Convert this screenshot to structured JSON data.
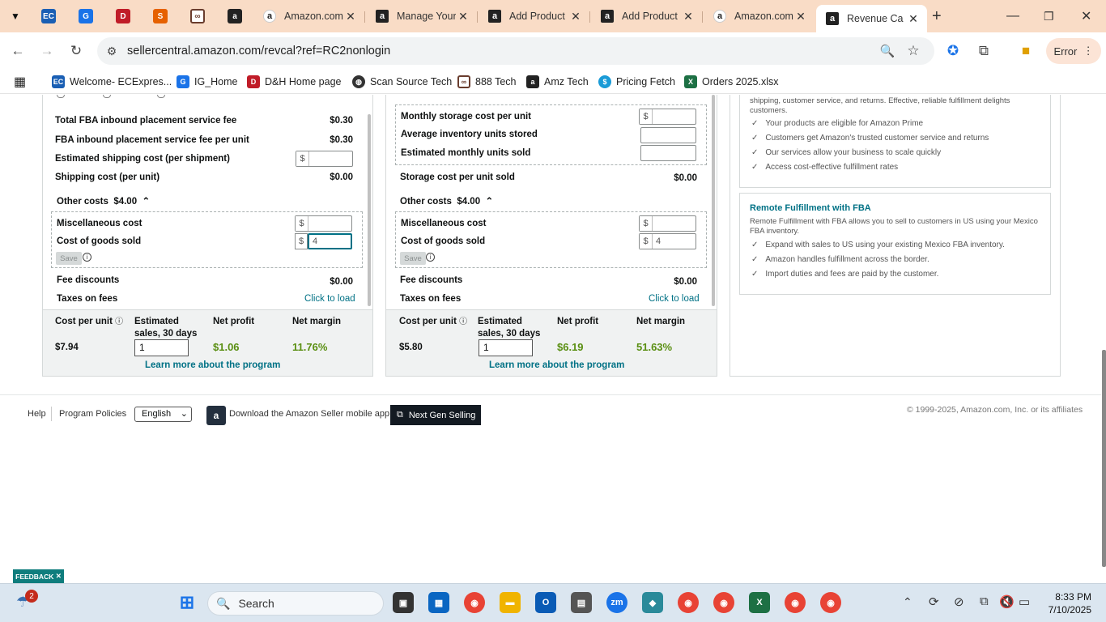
{
  "browser": {
    "tabs": [
      {
        "title": "Amazon.com",
        "favicon": "amazon-smile"
      },
      {
        "title": "Manage Your",
        "favicon": "amazon-a"
      },
      {
        "title": "Add Product",
        "favicon": "amazon-a"
      },
      {
        "title": "Add Product",
        "favicon": "amazon-a"
      },
      {
        "title": "Amazon.com",
        "favicon": "amazon-smile"
      },
      {
        "title": "Revenue Ca",
        "favicon": "amazon-a"
      }
    ],
    "url": "sellercentral.amazon.com/revcal?ref=RC2nonlogin",
    "profile_label": "Error",
    "bookmarks": [
      {
        "label": "Welcome- ECExpres...",
        "icon": "ec-icon",
        "color": "#1a5fb4"
      },
      {
        "label": "IG_Home",
        "icon": "ig-icon",
        "color": "#1a73e8"
      },
      {
        "label": "D&H Home page",
        "icon": "dh-icon",
        "color": "#c01c28"
      },
      {
        "label": "Scan Source Tech",
        "icon": "globe-icon",
        "color": "#333333"
      },
      {
        "label": "888 Tech",
        "icon": "link-icon",
        "color": "#6a3d2e"
      },
      {
        "label": "Amz Tech",
        "icon": "amazon-icon",
        "color": "#222222"
      },
      {
        "label": "Pricing Fetch",
        "icon": "dollar-icon",
        "color": "#1a9bd7"
      },
      {
        "label": "Orders 2025.xlsx",
        "icon": "excel-icon",
        "color": "#1d7044"
      }
    ]
  },
  "left": {
    "rows": [
      {
        "label": "Total FBA inbound placement service fee",
        "value": "$0.30"
      },
      {
        "label": "FBA inbound placement service fee per unit",
        "value": "$0.30"
      },
      {
        "label": "Estimated shipping cost (per shipment)",
        "value": ""
      },
      {
        "label": "Shipping cost (per unit)",
        "value": "$0.00"
      }
    ],
    "other_costs_label": "Other costs",
    "other_costs_value": "$4.00",
    "misc_label": "Miscellaneous cost",
    "misc_value": "",
    "cogs_label": "Cost of goods sold",
    "cogs_value": "4",
    "save": "Save",
    "fee_discounts_label": "Fee discounts",
    "fee_discounts_value": "$0.00",
    "taxes_label": "Taxes on fees",
    "taxes_link": "Click to load",
    "footer": {
      "cost_per_unit_label": "Cost per unit",
      "est_sales_label": "Estimated sales, 30 days",
      "net_profit_label": "Net profit",
      "net_margin_label": "Net margin",
      "cost_per_unit": "$7.94",
      "est_sales": "1",
      "net_profit": "$1.06",
      "net_margin": "11.76%",
      "learn_more": "Learn more about the program"
    }
  },
  "middle": {
    "rows": [
      {
        "label": "Monthly storage cost per unit"
      },
      {
        "label": "Average inventory units stored"
      },
      {
        "label": "Estimated monthly units sold"
      }
    ],
    "storage_label": "Storage cost per unit sold",
    "storage_value": "$0.00",
    "other_costs_label": "Other costs",
    "other_costs_value": "$4.00",
    "misc_label": "Miscellaneous cost",
    "misc_value": "",
    "cogs_label": "Cost of goods sold",
    "cogs_value": "4",
    "save": "Save",
    "fee_discounts_label": "Fee discounts",
    "fee_discounts_value": "$0.00",
    "taxes_label": "Taxes on fees",
    "taxes_link": "Click to load",
    "footer": {
      "cost_per_unit_label": "Cost per unit",
      "est_sales_label": "Estimated sales, 30 days",
      "net_profit_label": "Net profit",
      "net_margin_label": "Net margin",
      "cost_per_unit": "$5.80",
      "est_sales": "1",
      "net_profit": "$6.19",
      "net_margin": "51.63%",
      "learn_more": "Learn more about the program"
    }
  },
  "right": {
    "fba_intro": "shipping, customer service, and returns. Effective, reliable fulfillment delights customers.",
    "fba_benefits": [
      "Your products are eligible for Amazon Prime",
      "Customers get Amazon's trusted customer service and returns",
      "Our services allow your business to scale quickly",
      "Access cost-effective fulfillment rates"
    ],
    "remote_title": "Remote Fulfillment with FBA",
    "remote_desc": "Remote Fulfillment with FBA allows you to sell to customers in US using your Mexico FBA inventory.",
    "remote_benefits": [
      "Expand with sales to US using your existing Mexico FBA inventory.",
      "Amazon handles fulfillment across the border.",
      "Import duties and fees are paid by the customer."
    ]
  },
  "footer": {
    "help": "Help",
    "policies": "Program Policies",
    "language": "English",
    "app_text": "Download the Amazon Seller mobile app",
    "next_gen": "Next Gen Selling",
    "copyright": "© 1999-2025, Amazon.com, Inc. or its affiliates",
    "feedback": "FEEDBACK"
  },
  "taskbar": {
    "search_placeholder": "Search",
    "time": "8:33 PM",
    "date": "7/10/2025",
    "badge": "2"
  }
}
